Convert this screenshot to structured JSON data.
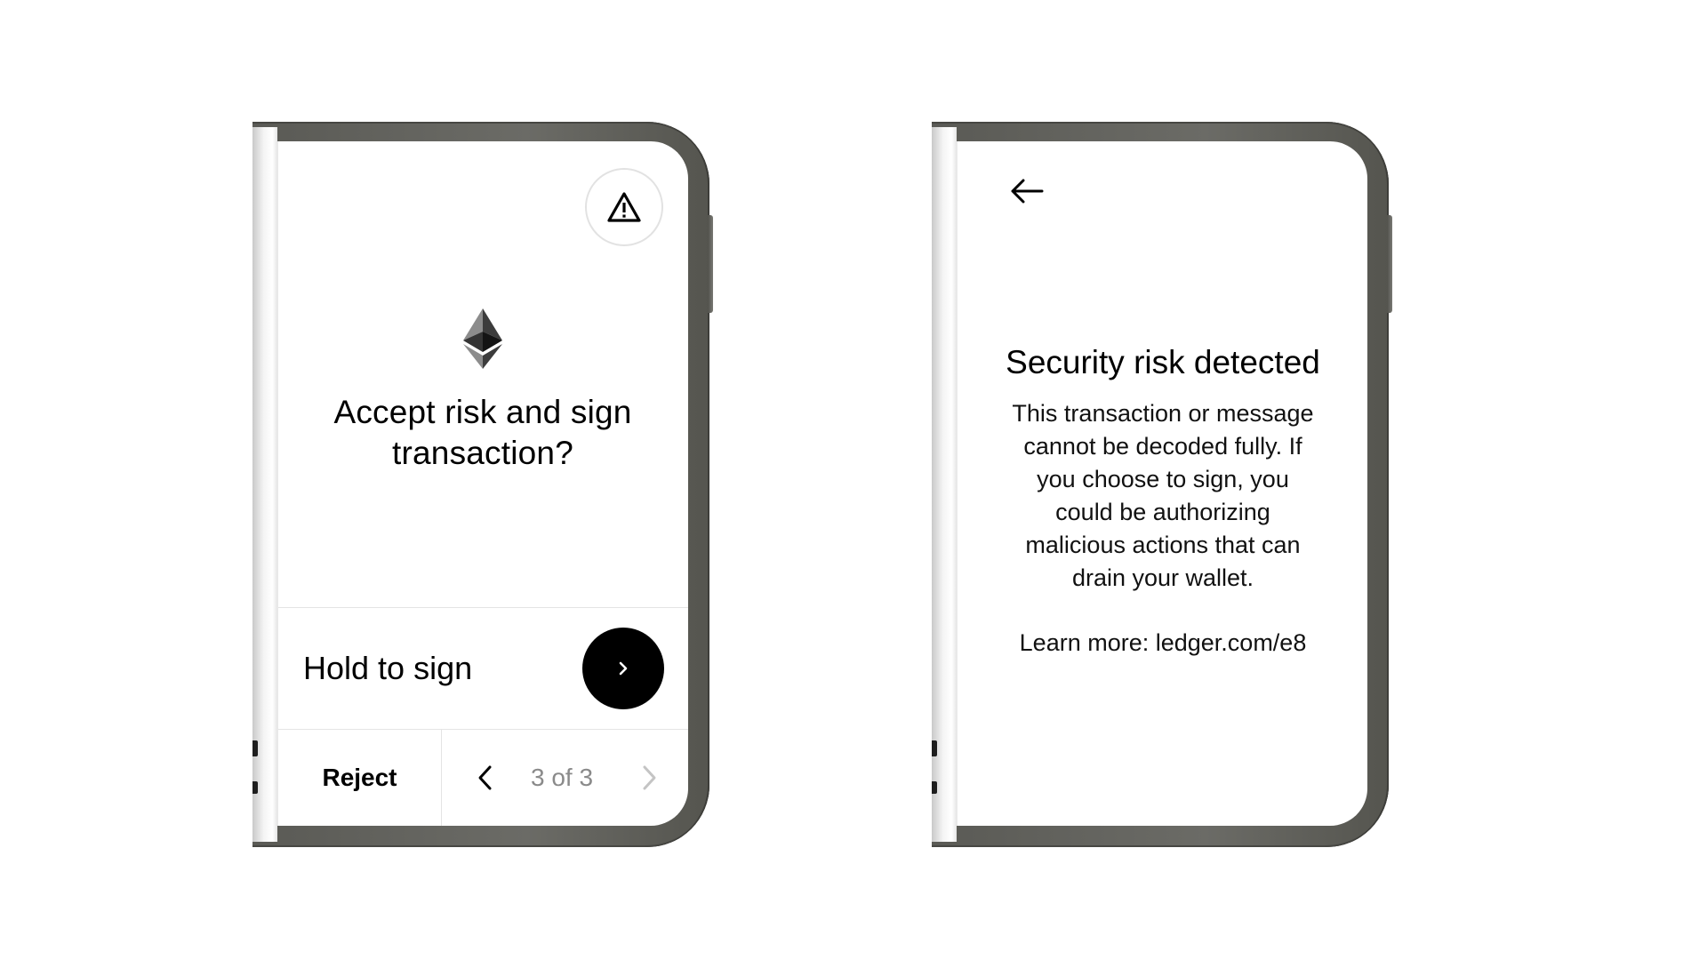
{
  "left_screen": {
    "warning_icon": "warning-triangle-icon",
    "chain_icon": "ethereum-icon",
    "title": "Accept risk and sign transaction?",
    "hold_to_sign_label": "Hold to sign",
    "hold_button_icon": "chevron-right-icon",
    "reject_label": "Reject",
    "pager": {
      "prev_icon": "chevron-left-icon",
      "count_text": "3 of 3",
      "next_icon": "chevron-right-icon"
    }
  },
  "right_screen": {
    "back_icon": "arrow-left-icon",
    "title": "Security risk detected",
    "body": "This transaction or message cannot be decoded fully. If you choose to sign, you could be authorizing malicious actions that can drain your wallet.",
    "learn_more": "Learn more: ledger.com/e8"
  },
  "colors": {
    "bezel": "#6b6b66",
    "screen": "#ffffff",
    "primary_text": "#000000",
    "muted_text": "#8a8a8a",
    "divider": "#e4e4e4"
  }
}
